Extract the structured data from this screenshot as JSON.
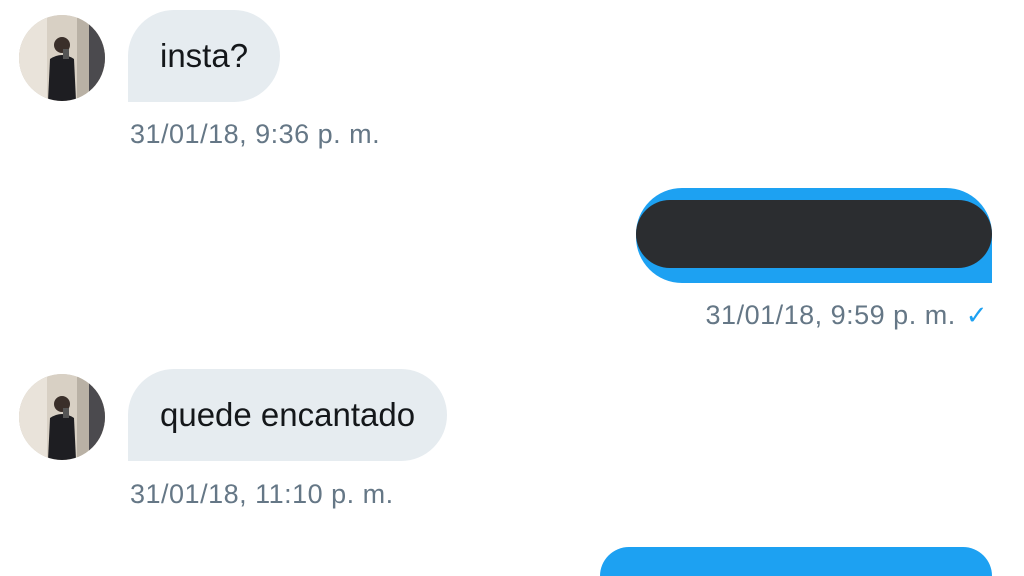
{
  "messages": [
    {
      "direction": "incoming",
      "text": "insta?",
      "timestamp": "31/01/18, 9:36 p. m."
    },
    {
      "direction": "outgoing",
      "text": "",
      "redacted": true,
      "timestamp": "31/01/18, 9:59 p. m.",
      "status_icon": "check-icon"
    },
    {
      "direction": "incoming",
      "text": "quede encantado",
      "timestamp": "31/01/18, 11:10 p. m."
    },
    {
      "direction": "outgoing",
      "text": ""
    }
  ],
  "colors": {
    "incoming_bubble": "#e6ecf0",
    "outgoing_bubble": "#1da1f2",
    "timestamp_text": "#657786",
    "redaction": "#2b2d30"
  }
}
